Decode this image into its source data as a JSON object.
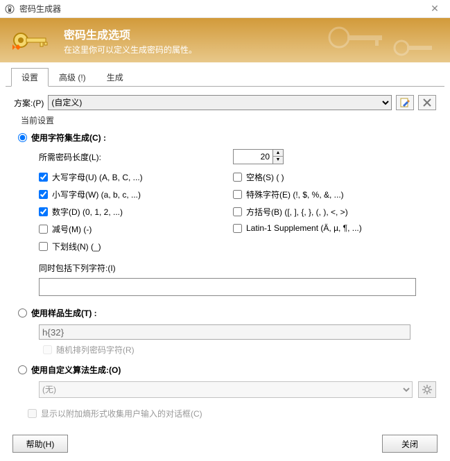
{
  "window": {
    "title": "密码生成器"
  },
  "banner": {
    "title": "密码生成选项",
    "subtitle": "在这里你可以定义生成密码的属性。"
  },
  "tabs": {
    "settings": "设置",
    "advanced": "高级 (!)",
    "generate": "生成"
  },
  "scheme": {
    "label": "方案:(P)",
    "selected": "(自定义)"
  },
  "current_settings_label": "当前设置",
  "method_charset": {
    "label": "使用字符集生成(C) :",
    "length_label": "所需密码长度(L):",
    "length_value": "20",
    "checks": {
      "upper": {
        "label": "大写字母(U) (A, B, C, ...)",
        "checked": true
      },
      "lower": {
        "label": "小写字母(W) (a, b, c, ...)",
        "checked": true
      },
      "digits": {
        "label": "数字(D) (0, 1, 2, ...)",
        "checked": true
      },
      "minus": {
        "label": "减号(M) (-)",
        "checked": false
      },
      "underline": {
        "label": "下划线(N) (_)",
        "checked": false
      },
      "space": {
        "label": "空格(S) ( )",
        "checked": false
      },
      "special": {
        "label": "特殊字符(E) (!, $, %, &, ...)",
        "checked": false
      },
      "brackets": {
        "label": "方括号(B) ([, ], {, }, (, ), <, >)",
        "checked": false
      },
      "latin1": {
        "label": "Latin-1 Supplement (Ä, µ, ¶, ...)",
        "checked": false
      }
    },
    "also_include_label": "同时包括下列字符:(I)",
    "also_include_value": ""
  },
  "method_pattern": {
    "label": "使用样品生成(T) :",
    "pattern_value": "h{32}",
    "permute_label": "随机排列密码字符(R)"
  },
  "method_algo": {
    "label": "使用自定义算法生成:(O)",
    "selected": "(无)"
  },
  "entropy_checkbox_label": "显示以附加熵形式收集用户输入的对话框(C)",
  "buttons": {
    "help": "帮助(H)",
    "close": "关闭"
  }
}
